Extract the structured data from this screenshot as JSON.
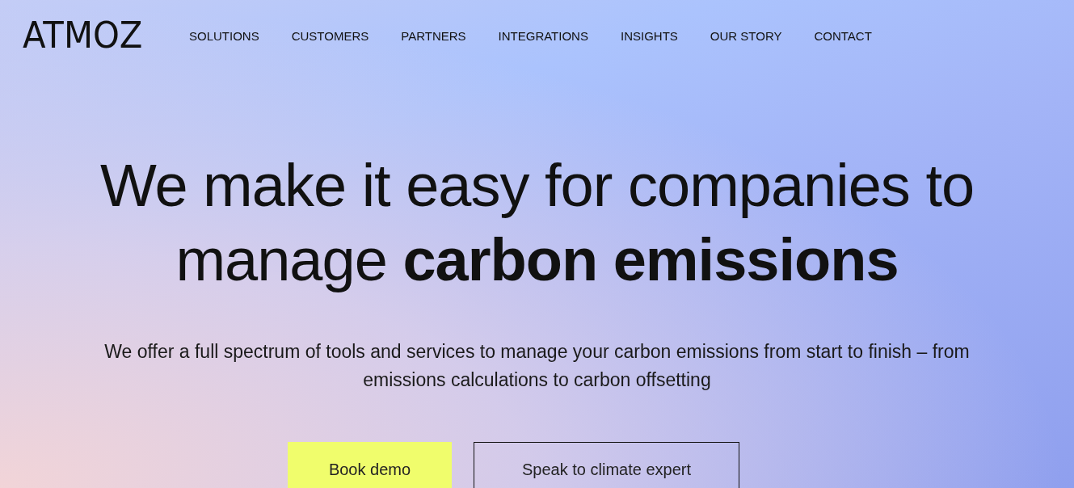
{
  "logo": "ATMOZ",
  "nav": [
    "SOLUTIONS",
    "CUSTOMERS",
    "PARTNERS",
    "INTEGRATIONS",
    "INSIGHTS",
    "OUR STORY",
    "CONTACT"
  ],
  "hero": {
    "headline": "We make it easy for companies to manage **carbon emissions**",
    "subtitle": "We offer a full spectrum of tools and services to manage your carbon emissions from start to finish – from emissions calculations to carbon offsetting",
    "buttons": [
      {
        "label": "Book demo",
        "kind": "primary"
      },
      {
        "label": "Speak to climate expert",
        "kind": "outline"
      }
    ]
  }
}
